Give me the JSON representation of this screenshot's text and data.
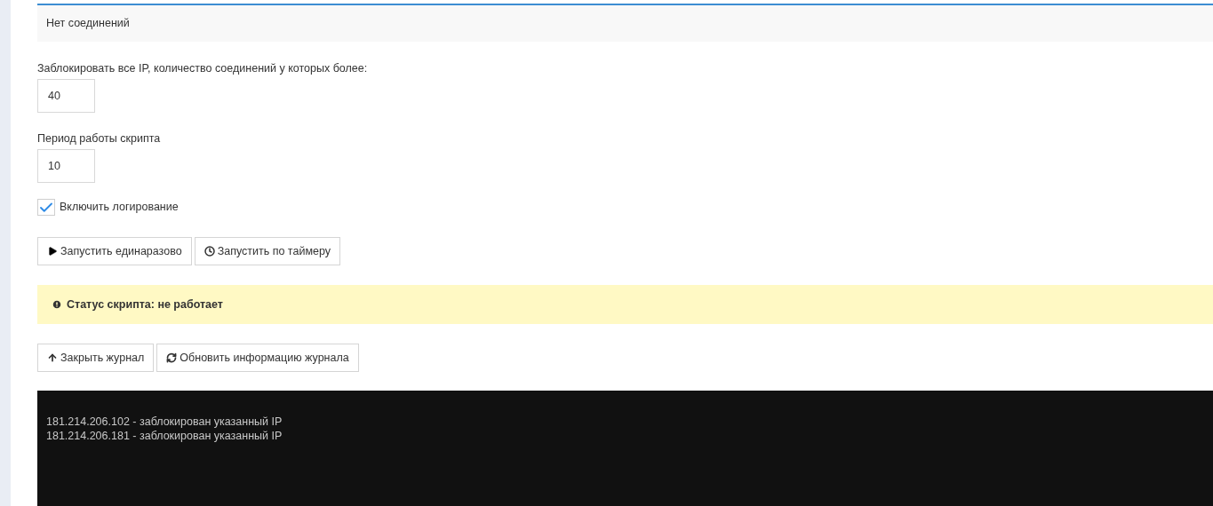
{
  "connections": {
    "text": "Нет соединений"
  },
  "fields": [
    {
      "label": "Заблокировать все IP, количество соединений у которых более:",
      "value": "40"
    },
    {
      "label": "Период работы скрипта",
      "value": "10"
    }
  ],
  "logging": {
    "label": "Включить логирование",
    "checked": true
  },
  "run_buttons": [
    {
      "kind": "play",
      "label": "Запустить единаразово"
    },
    {
      "kind": "clock",
      "label": "Запустить по таймеру"
    }
  ],
  "status": {
    "text": "Статус скрипта: не работает"
  },
  "log_buttons": [
    {
      "kind": "up",
      "label": "Закрыть журнал"
    },
    {
      "kind": "refresh",
      "label": "Обновить информацию журнала"
    }
  ],
  "log": [
    "181.214.206.102 - заблокирован указанный IP",
    "181.214.206.181 - заблокирован указанный IP"
  ]
}
